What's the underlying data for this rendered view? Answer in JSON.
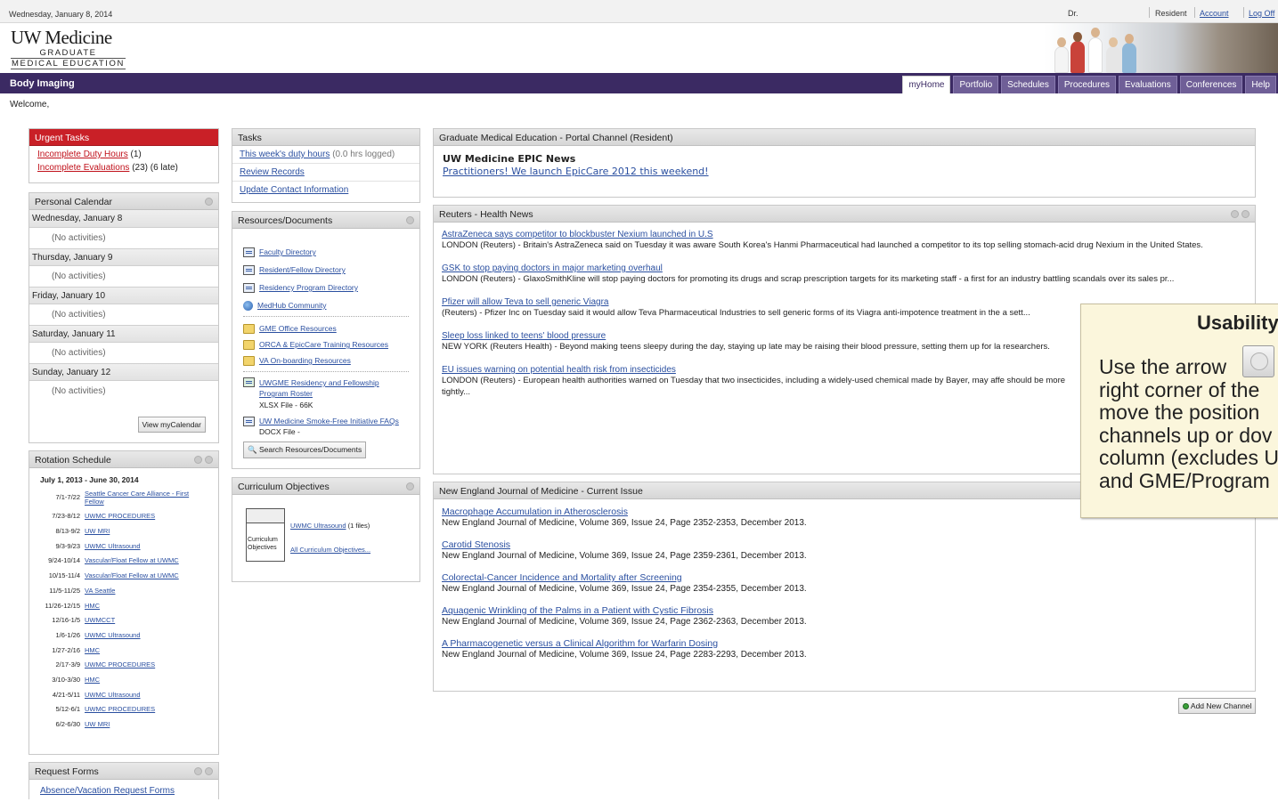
{
  "topbar": {
    "date": "Wednesday, January 8, 2014",
    "title_prefix": "Dr.",
    "role": "Resident",
    "account": "Account",
    "logout": "Log Off"
  },
  "header": {
    "logo_line1": "UW Medicine",
    "logo_line2": "GRADUATE",
    "logo_line3": "MEDICAL EDUCATION"
  },
  "nav": {
    "department": "Body Imaging",
    "tabs": [
      "myHome",
      "Portfolio",
      "Schedules",
      "Procedures",
      "Evaluations",
      "Conferences",
      "Help"
    ]
  },
  "welcome": "Welcome,",
  "urgent": {
    "title": "Urgent Tasks",
    "items": [
      {
        "link": "Incomplete Duty Hours",
        "count": "(1)",
        "extra": ""
      },
      {
        "link": "Incomplete Evaluations",
        "count": "(23)",
        "extra": "(6 late)"
      }
    ]
  },
  "calendar": {
    "title": "Personal Calendar",
    "days": [
      {
        "day": "Wednesday, January 8",
        "note": "(No activities)"
      },
      {
        "day": "Thursday, January 9",
        "note": "(No activities)"
      },
      {
        "day": "Friday, January 10",
        "note": "(No activities)"
      },
      {
        "day": "Saturday, January 11",
        "note": "(No activities)"
      },
      {
        "day": "Sunday, January 12",
        "note": "(No activities)"
      }
    ],
    "button": "View myCalendar"
  },
  "rotation": {
    "title": "Rotation Schedule",
    "period": "July 1, 2013 - June 30, 2014",
    "rows": [
      {
        "date": "7/1-7/22",
        "loc": "Seattle Cancer Care Alliance - First Fellow"
      },
      {
        "date": "7/23-8/12",
        "loc": "UWMC PROCEDURES"
      },
      {
        "date": "8/13-9/2",
        "loc": "UW MRI"
      },
      {
        "date": "9/3-9/23",
        "loc": "UWMC Ultrasound"
      },
      {
        "date": "9/24-10/14",
        "loc": "Vascular/Float Fellow at UWMC"
      },
      {
        "date": "10/15-11/4",
        "loc": "Vascular/Float Fellow at UWMC"
      },
      {
        "date": "11/5-11/25",
        "loc": "VA Seattle"
      },
      {
        "date": "11/26-12/15",
        "loc": "HMC"
      },
      {
        "date": "12/16-1/5",
        "loc": "UWMCCT"
      },
      {
        "date": "1/6-1/26",
        "loc": "UWMC Ultrasound"
      },
      {
        "date": "1/27-2/16",
        "loc": "HMC"
      },
      {
        "date": "2/17-3/9",
        "loc": "UWMC PROCEDURES"
      },
      {
        "date": "3/10-3/30",
        "loc": "HMC"
      },
      {
        "date": "4/21-5/11",
        "loc": "UWMC Ultrasound"
      },
      {
        "date": "5/12-6/1",
        "loc": "UWMC PROCEDURES"
      },
      {
        "date": "6/2-6/30",
        "loc": "UW MRI"
      }
    ]
  },
  "requests": {
    "title": "Request Forms",
    "first_item": "Absence/Vacation Request Forms"
  },
  "tasks": {
    "title": "Tasks",
    "duty_link": "This week's duty hours",
    "duty_note": "(0.0 hrs logged)",
    "review": "Review Records",
    "update": "Update Contact Information"
  },
  "resources": {
    "title": "Resources/Documents",
    "group1": [
      "Faculty Directory",
      "Resident/Fellow Directory",
      "Residency Program Directory",
      "MedHub Community"
    ],
    "group2": [
      "GME Office Resources",
      "ORCA & EpicCare Training Resources",
      "VA On-boarding Resources"
    ],
    "file1": {
      "name": "UWGME Residency and Fellowship Program Roster",
      "meta": "XLSX File - 66K"
    },
    "file2": {
      "name": "UW Medicine Smoke-Free Initiative FAQs",
      "meta": "DOCX File -"
    },
    "search_button": "Search Resources/Documents"
  },
  "curriculum": {
    "title": "Curriculum Objectives",
    "box_label": "Curriculum Objectives",
    "link1": "UWMC Ultrasound",
    "link1_note": "(1 files)",
    "link2": "All Curriculum Objectives..."
  },
  "gme_channel": {
    "title": "Graduate Medical Education - Portal Channel (Resident)",
    "headline": "UW Medicine EPIC News",
    "link": "Practitioners!  We launch EpicCare 2012 this weekend!"
  },
  "reuters": {
    "title": "Reuters - Health News",
    "items": [
      {
        "title": "AstraZeneca says competitor to blockbuster Nexium launched in U.S",
        "body": "LONDON (Reuters) - Britain's AstraZeneca said on Tuesday it was aware South Korea's Hanmi Pharmaceutical had launched a competitor to its top selling stomach-acid drug Nexium in the United States."
      },
      {
        "title": "GSK to stop paying doctors in major marketing overhaul",
        "body": "LONDON (Reuters) - GlaxoSmithKline will stop paying doctors for promoting its drugs and scrap prescription targets for its marketing staff - a first for an industry battling scandals over its sales pr..."
      },
      {
        "title": "Pfizer will allow Teva to sell generic Viagra",
        "body": "(Reuters) - Pfizer Inc on Tuesday said it would allow Teva Pharmaceutical Industries to sell generic forms of its Viagra anti-impotence treatment in the a sett..."
      },
      {
        "title": "Sleep loss linked to teens' blood pressure",
        "body": "NEW YORK (Reuters Health) - Beyond making teens sleepy during the day, staying up late may be raising their blood pressure, setting them up for la researchers."
      },
      {
        "title": "EU issues warning on potential health risk from insecticides",
        "body": "LONDON (Reuters) - European health authorities warned on Tuesday that two insecticides, including a widely-used chemical made by Bayer, may affe should be more tightly..."
      }
    ]
  },
  "nejm": {
    "title": "New England Journal of Medicine - Current Issue",
    "items": [
      {
        "title": "Macrophage Accumulation in Atherosclerosis",
        "body": "New England Journal of Medicine, Volume 369, Issue 24, Page 2352-2353, December 2013."
      },
      {
        "title": "Carotid Stenosis",
        "body": "New England Journal of Medicine, Volume 369, Issue 24, Page 2359-2361, December 2013."
      },
      {
        "title": "Colorectal-Cancer Incidence and Mortality after Screening",
        "body": "New England Journal of Medicine, Volume 369, Issue 24, Page 2354-2355, December 2013."
      },
      {
        "title": "Aquagenic Wrinkling of the Palms in a Patient with Cystic Fibrosis",
        "body": "New England Journal of Medicine, Volume 369, Issue 24, Page 2362-2363, December 2013."
      },
      {
        "title": "A Pharmacogenetic versus a Clinical Algorithm for Warfarin Dosing",
        "body": "New England Journal of Medicine, Volume 369, Issue 24, Page 2283-2293, December 2013."
      }
    ]
  },
  "add_channel": "Add New Channel",
  "usability": {
    "title": "Usability",
    "lines": [
      "Use the arrow",
      "right corner of the",
      "move the position",
      "channels up or dov",
      "column (excludes U",
      "and GME/Program"
    ]
  },
  "colors": {
    "nav_bg": "#3b2a63",
    "urgent_red": "#c92027",
    "link_blue": "#2a4fa0"
  }
}
